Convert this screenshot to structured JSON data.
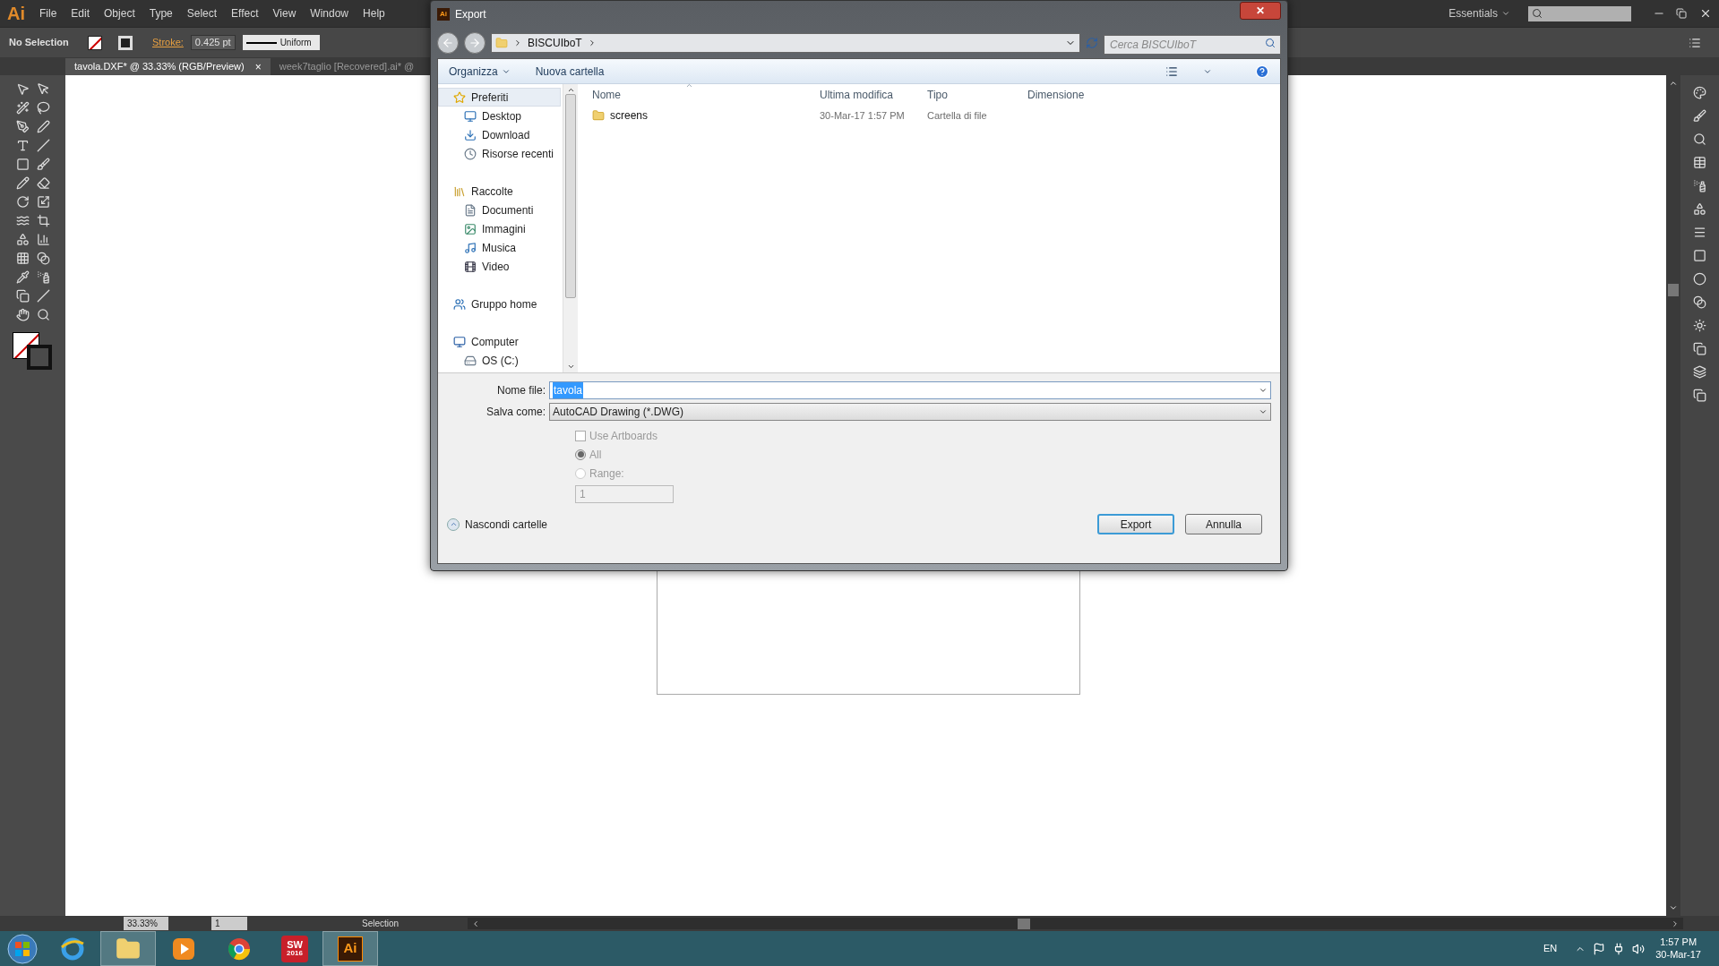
{
  "app": {
    "logo": "Ai",
    "menu": [
      "File",
      "Edit",
      "Object",
      "Type",
      "Select",
      "Effect",
      "View",
      "Window",
      "Help"
    ],
    "workspace": "Essentials"
  },
  "control_bar": {
    "selection": "No Selection",
    "stroke_label": "Stroke:",
    "stroke_weight": "0.425 pt",
    "profile": "Uniform"
  },
  "tabs": [
    {
      "label": "tavola.DXF* @ 33.33% (RGB/Preview)",
      "selected": true,
      "close": "×"
    },
    {
      "label": "week7taglio [Recovered].ai* @",
      "selected": false
    }
  ],
  "status_bar": {
    "zoom": "33.33%",
    "artboard": "1",
    "tool": "Selection"
  },
  "dialog": {
    "icon": "Ai",
    "title": "Export",
    "close": "✕",
    "path": [
      "BISCUIboT"
    ],
    "search": {
      "placeholder": "Cerca BISCUIboT"
    },
    "toolbar": {
      "organize": "Organizza",
      "new_folder": "Nuova cartella"
    },
    "nav": [
      {
        "label": "Preferiti",
        "kind": "star",
        "selected": true,
        "children": [
          {
            "label": "Desktop",
            "kind": "desktop",
            "selected": false
          },
          {
            "label": "Download",
            "kind": "download",
            "selected": false
          },
          {
            "label": "Risorse recenti",
            "kind": "recent",
            "selected": false
          }
        ]
      },
      {
        "label": "Raccolte",
        "kind": "library",
        "selected": false,
        "children": [
          {
            "label": "Documenti",
            "kind": "doc",
            "selected": false
          },
          {
            "label": "Immagini",
            "kind": "image",
            "selected": false
          },
          {
            "label": "Musica",
            "kind": "music",
            "selected": false
          },
          {
            "label": "Video",
            "kind": "video",
            "selected": false
          }
        ]
      },
      {
        "label": "Gruppo home",
        "kind": "homegroup",
        "selected": false
      },
      {
        "label": "Computer",
        "kind": "computer",
        "selected": false,
        "children": [
          {
            "label": "OS (C:)",
            "kind": "drive",
            "selected": false
          }
        ]
      }
    ],
    "columns": [
      "Nome",
      "Ultima modifica",
      "Tipo",
      "Dimensione"
    ],
    "rows": [
      {
        "name": "screens",
        "modified": "30-Mar-17 1:57 PM",
        "type": "Cartella di file",
        "selected": false
      }
    ],
    "file_name": {
      "label": "Nome file:",
      "value": "tavola"
    },
    "save_as": {
      "label": "Salva come:",
      "value": "AutoCAD Drawing (*.DWG)"
    },
    "options": {
      "disabled": true,
      "use_artboards": {
        "label": "Use Artboards",
        "checked": false
      },
      "radios": [
        {
          "label": "All",
          "selected": true
        },
        {
          "label": "Range:",
          "selected": false
        }
      ],
      "range": "1"
    },
    "hide_folders": "Nascondi cartelle",
    "buttons": [
      {
        "label": "Export",
        "kind": "default"
      },
      {
        "label": "Annulla",
        "kind": "normal"
      }
    ]
  },
  "taskbar": {
    "apps": [
      {
        "kind": "ie",
        "selected": false
      },
      {
        "kind": "explorer",
        "selected": true
      },
      {
        "kind": "media",
        "selected": false
      },
      {
        "kind": "chrome",
        "selected": false
      },
      {
        "kind": "sw",
        "label": "SW",
        "sub": "2016",
        "selected": false
      },
      {
        "kind": "ai",
        "label": "Ai",
        "selected": true
      }
    ],
    "language": "EN",
    "time": "1:57 PM",
    "date": "30-Mar-17"
  }
}
